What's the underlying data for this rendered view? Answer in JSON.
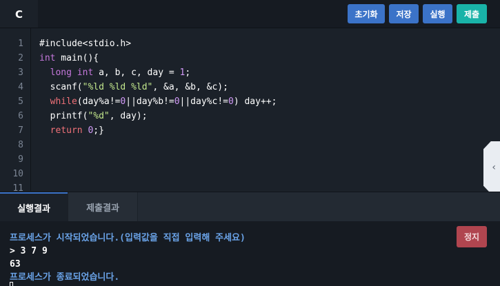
{
  "header": {
    "language_tab": "C",
    "buttons": {
      "reset": "초기화",
      "save": "저장",
      "run": "실행",
      "submit": "제출"
    }
  },
  "editor": {
    "line_numbers": [
      "1",
      "2",
      "3",
      "4",
      "5",
      "6",
      "7",
      "8",
      "9",
      "10",
      "11"
    ],
    "code": {
      "l1": "#include<stdio.h>",
      "l2_kw": "int",
      "l2_rest": " main(){",
      "l3_kw1": "long",
      "l3_kw2": "int",
      "l3_mid": " a, b, c, day = ",
      "l3_num": "1",
      "l3_end": ";",
      "l4_a": "scanf(",
      "l4_str": "\"%ld %ld %ld\"",
      "l4_b": ", &a, &b, &c);",
      "l5_kw": "while",
      "l5_a": "(day%a!=",
      "l5_n1": "0",
      "l5_b": "||day%b!=",
      "l5_n2": "0",
      "l5_c": "||day%c!=",
      "l5_n3": "0",
      "l5_d": ") day++;",
      "l6_a": "printf(",
      "l6_str": "\"%d\"",
      "l6_b": ", day);",
      "l7_kw": "return",
      "l7_num": "0",
      "l7_end": ";}"
    },
    "side_handle_icon": "chevron-left-icon",
    "side_handle_glyph": "‹"
  },
  "bottom": {
    "tabs": {
      "result": "실행결과",
      "submit_result": "제출결과"
    },
    "stop_button": "정지",
    "output": {
      "line1": "프로세스가 시작되었습니다.(입력값을 직접 입력해 주세요)",
      "line2": "> 3 7 9",
      "line3": "63",
      "line4": "프로세스가 종료되었습니다."
    }
  }
}
